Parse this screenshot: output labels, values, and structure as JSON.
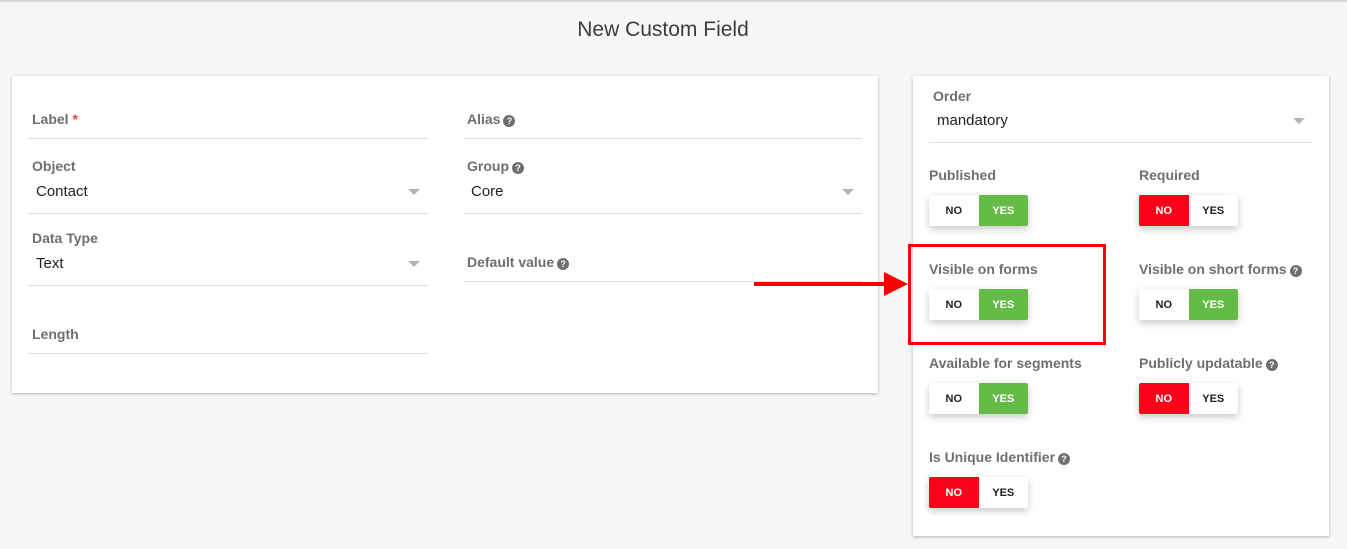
{
  "page": {
    "title": "New Custom Field"
  },
  "form": {
    "label": {
      "label": "Label",
      "required_mark": "*",
      "value": ""
    },
    "alias": {
      "label": "Alias",
      "help_icon": "question-circle-icon",
      "value": ""
    },
    "object": {
      "label": "Object",
      "value": "Contact"
    },
    "group": {
      "label": "Group",
      "help_icon": "question-circle-icon",
      "value": "Core"
    },
    "data_type": {
      "label": "Data Type",
      "value": "Text"
    },
    "default_value": {
      "label": "Default value",
      "help_icon": "question-circle-icon",
      "value": ""
    },
    "length": {
      "label": "Length",
      "value": ""
    }
  },
  "settings": {
    "order": {
      "label": "Order",
      "value": "mandatory"
    },
    "toggles": [
      {
        "key": "published",
        "label": "Published",
        "help": false,
        "value": "YES"
      },
      {
        "key": "required",
        "label": "Required",
        "help": false,
        "value": "NO"
      },
      {
        "key": "visible_on_forms",
        "label": "Visible on forms",
        "help": false,
        "value": "YES"
      },
      {
        "key": "visible_on_short_forms",
        "label": "Visible on short forms",
        "help": true,
        "value": "YES"
      },
      {
        "key": "available_for_segments",
        "label": "Available for segments",
        "help": false,
        "value": "YES"
      },
      {
        "key": "publicly_updatable",
        "label": "Publicly updatable",
        "help": true,
        "value": "NO"
      },
      {
        "key": "is_unique_identifier",
        "label": "Is Unique Identifier",
        "help": true,
        "value": "NO"
      }
    ],
    "no_label": "NO",
    "yes_label": "YES"
  },
  "colors": {
    "yes_active": "#64bb45",
    "no_active": "#ff0019",
    "annotation": "#ff0000"
  },
  "help_glyph": "?"
}
